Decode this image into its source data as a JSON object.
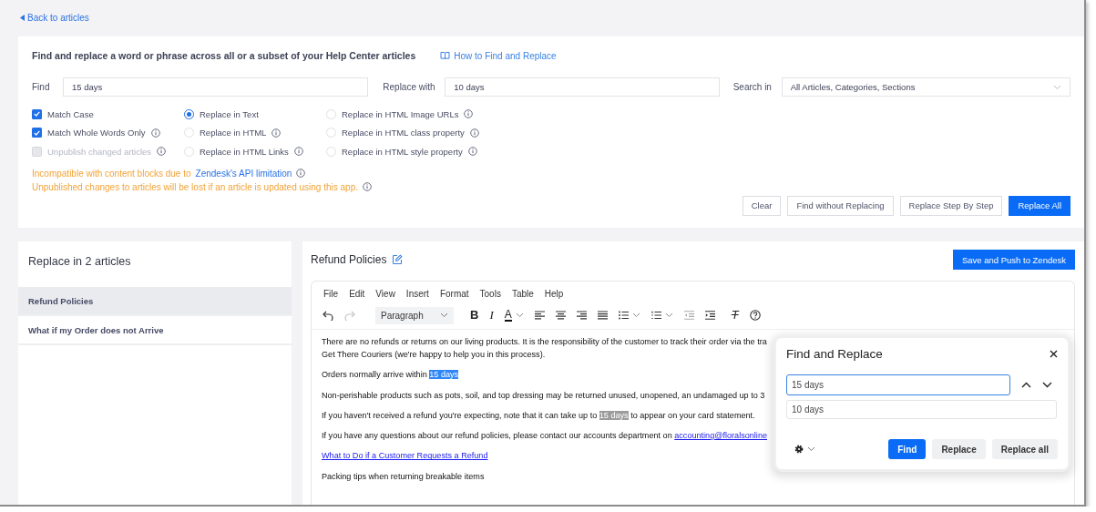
{
  "back_link": "Back to articles",
  "search_panel": {
    "heading": "Find and replace a word or phrase across all or a subset of your Help Center articles",
    "help_link": "How to Find and Replace",
    "find": {
      "label": "Find",
      "value": "15 days"
    },
    "replace": {
      "label": "Replace with",
      "value": "10 days"
    },
    "search_in": {
      "label": "Search in",
      "value": "All Articles, Categories, Sections"
    },
    "checkboxes": [
      {
        "label": "Match Case",
        "checked": true,
        "disabled": false,
        "info": false
      },
      {
        "label": "Match Whole Words Only",
        "checked": true,
        "disabled": false,
        "info": true
      },
      {
        "label": "Unpublish changed articles",
        "checked": false,
        "disabled": true,
        "info": true
      }
    ],
    "replace_modes": [
      {
        "label": "Replace in Text",
        "selected": true,
        "info": false
      },
      {
        "label": "Replace in HTML",
        "selected": false,
        "info": true
      },
      {
        "label": "Replace in HTML Links",
        "selected": false,
        "info": true
      },
      {
        "label": "Replace in HTML Image URLs",
        "selected": false,
        "info": true
      },
      {
        "label": "Replace in HTML class property",
        "selected": false,
        "info": true
      },
      {
        "label": "Replace in HTML style property",
        "selected": false,
        "info": true
      }
    ],
    "warnings": [
      {
        "text": "Incompatible with content blocks due to",
        "link": "Zendesk's API limitation"
      },
      {
        "text": "Unpublished changes to articles will be lost if an article is updated using this app."
      }
    ],
    "buttons": [
      {
        "label": "Clear",
        "primary": false
      },
      {
        "label": "Find without Replacing",
        "primary": false
      },
      {
        "label": "Replace Step By Step",
        "primary": false
      },
      {
        "label": "Replace All",
        "primary": true
      }
    ]
  },
  "articles": {
    "heading": "Replace in 2 articles",
    "items": [
      {
        "title": "Refund Policies",
        "selected": true
      },
      {
        "title": "What if my Order does not Arrive",
        "selected": false
      }
    ]
  },
  "editor": {
    "title": "Refund Policies",
    "save_button": "Save and Push to Zendesk",
    "menu": [
      "File",
      "Edit",
      "View",
      "Insert",
      "Format",
      "Tools",
      "Table",
      "Help"
    ],
    "toolbar": {
      "redo_enabled": false,
      "block_format": "Paragraph",
      "bold": "B",
      "italic": "I",
      "text_color": "A",
      "clear_format": "T"
    },
    "paragraphs": [
      {
        "segments": [
          {
            "kind": "text",
            "text": "There are no refunds or returns on our living products. It is the responsibility of the customer to track their order via the tra\nGet There Couriers (we're happy to help you in this process)."
          }
        ]
      },
      {
        "segments": [
          {
            "kind": "text",
            "text": "Orders normally arrive within "
          },
          {
            "kind": "current-match",
            "text": "15 days"
          }
        ]
      },
      {
        "segments": [
          {
            "kind": "text",
            "text": "Non-perishable products such as pots, soil, and top dressing may be returned unused, unopened, an undamaged up to 3"
          }
        ]
      },
      {
        "segments": [
          {
            "kind": "text",
            "text": "If you haven't received a refund you're expecting, note that it can take up to "
          },
          {
            "kind": "match",
            "text": "15 days"
          },
          {
            "kind": "text",
            "text": " to appear on your card statement."
          }
        ]
      },
      {
        "segments": [
          {
            "kind": "text",
            "text": "If you have any questions about our refund policies, please contact our accounts department on "
          },
          {
            "kind": "link",
            "text": "accounting@floralsonline"
          }
        ]
      },
      {
        "segments": [
          {
            "kind": "link",
            "text": "What to Do if a Customer Requests a Refund"
          }
        ]
      },
      {
        "segments": [
          {
            "kind": "text",
            "text": "Packing tips when returning breakable items"
          }
        ]
      }
    ]
  },
  "find_dialog": {
    "title": "Find and Replace",
    "find_value": "15 days",
    "find_focused": true,
    "replace_value": "10 days",
    "buttons": [
      {
        "label": "Find",
        "primary": true
      },
      {
        "label": "Replace",
        "primary": false
      },
      {
        "label": "Replace all",
        "primary": false
      }
    ]
  }
}
